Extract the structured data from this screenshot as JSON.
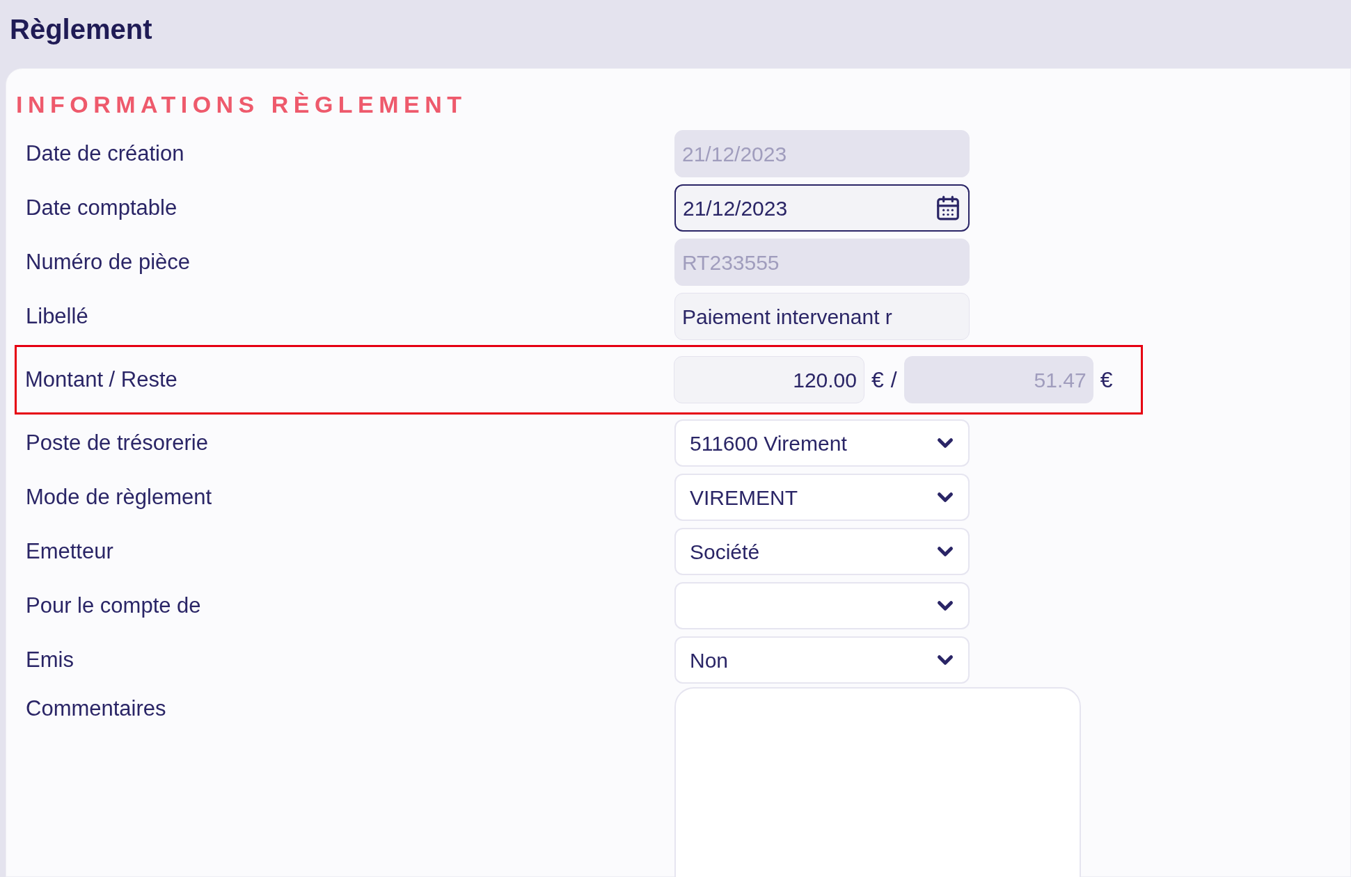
{
  "header": {
    "title": "Règlement"
  },
  "section": {
    "title": "INFORMATIONS RÈGLEMENT"
  },
  "fields": [
    {
      "label": "Date de création",
      "kind": "text",
      "value": "21/12/2023",
      "disabled": true,
      "focused": false
    },
    {
      "label": "Date comptable",
      "kind": "date",
      "value": "21/12/2023",
      "disabled": false,
      "focused": true
    },
    {
      "label": "Numéro de pièce",
      "kind": "text",
      "value": "RT233555",
      "disabled": true,
      "focused": false
    },
    {
      "label": "Libellé",
      "kind": "text",
      "value": "Paiement intervenant r",
      "disabled": false,
      "focused": false
    },
    {
      "label": "Montant / Reste",
      "kind": "amount",
      "highlighted": true,
      "amount": {
        "value": "120.00",
        "disabled": false,
        "unit": "€"
      },
      "separator": "/",
      "rest": {
        "value": "51.47",
        "disabled": true,
        "unit": "€"
      }
    },
    {
      "label": "Poste de trésorerie",
      "kind": "select",
      "value": "511600 Virement",
      "disabled": false,
      "focused": false
    },
    {
      "label": "Mode de règlement",
      "kind": "select",
      "value": "VIREMENT",
      "disabled": false,
      "focused": false
    },
    {
      "label": "Emetteur",
      "kind": "select",
      "value": "Société",
      "disabled": false,
      "focused": false
    },
    {
      "label": "Pour le compte de",
      "kind": "select",
      "disabled": false,
      "focused": false
    },
    {
      "label": "Emis",
      "kind": "select",
      "value": "Non",
      "disabled": false,
      "focused": false
    },
    {
      "label": "Commentaires",
      "kind": "textarea",
      "disabled": false,
      "focused": false
    }
  ]
}
